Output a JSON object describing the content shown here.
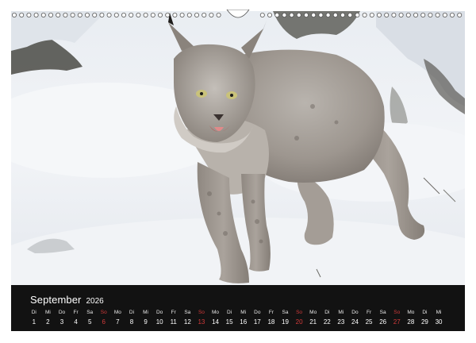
{
  "calendar": {
    "month": "September",
    "year": "2026",
    "days": [
      {
        "wd": "Di",
        "dn": "1"
      },
      {
        "wd": "Mi",
        "dn": "2"
      },
      {
        "wd": "Do",
        "dn": "3"
      },
      {
        "wd": "Fr",
        "dn": "4"
      },
      {
        "wd": "Sa",
        "dn": "5"
      },
      {
        "wd": "So",
        "dn": "6",
        "sunday": true
      },
      {
        "wd": "Mo",
        "dn": "7"
      },
      {
        "wd": "Di",
        "dn": "8"
      },
      {
        "wd": "Mi",
        "dn": "9"
      },
      {
        "wd": "Do",
        "dn": "10"
      },
      {
        "wd": "Fr",
        "dn": "11"
      },
      {
        "wd": "Sa",
        "dn": "12"
      },
      {
        "wd": "So",
        "dn": "13",
        "sunday": true
      },
      {
        "wd": "Mo",
        "dn": "14"
      },
      {
        "wd": "Di",
        "dn": "15"
      },
      {
        "wd": "Mi",
        "dn": "16"
      },
      {
        "wd": "Do",
        "dn": "17"
      },
      {
        "wd": "Fr",
        "dn": "18"
      },
      {
        "wd": "Sa",
        "dn": "19"
      },
      {
        "wd": "So",
        "dn": "20",
        "sunday": true
      },
      {
        "wd": "Mo",
        "dn": "21"
      },
      {
        "wd": "Di",
        "dn": "22"
      },
      {
        "wd": "Mi",
        "dn": "23"
      },
      {
        "wd": "Do",
        "dn": "24"
      },
      {
        "wd": "Fr",
        "dn": "25"
      },
      {
        "wd": "Sa",
        "dn": "26"
      },
      {
        "wd": "So",
        "dn": "27",
        "sunday": true
      },
      {
        "wd": "Mo",
        "dn": "28"
      },
      {
        "wd": "Di",
        "dn": "29"
      },
      {
        "wd": "Mi",
        "dn": "30"
      }
    ]
  },
  "colors": {
    "strip_background": "#121212",
    "sunday": "#d23a3a",
    "text": "#ffffff"
  },
  "photo": {
    "subject": "lynx-in-snow"
  }
}
